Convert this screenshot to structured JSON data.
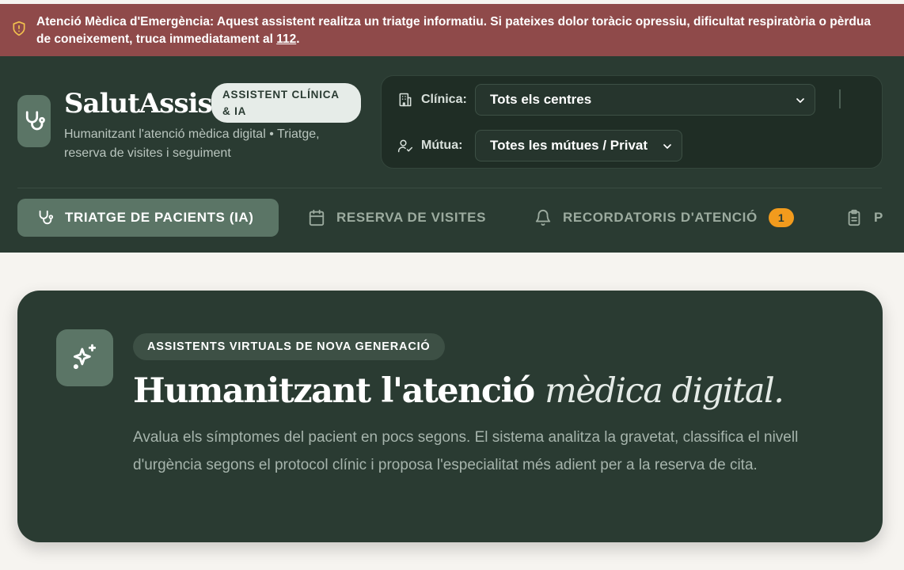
{
  "alert": {
    "title": "Atenció Mèdica d'Emergència:",
    "text": " Aquest assistent realitza un triatge informatiu. Si pateixes dolor toràcic opressiu, dificultat respiratòria o pèrdua de coneixement, truca immediatament al ",
    "phone": "112",
    "end": ".",
    "icon": "shield-alert-icon"
  },
  "brand": {
    "name": "SalutAssist",
    "badge": "ASSISTENT CLÍNICA & IA",
    "tagline": "Humanitzant l'atenció mèdica digital • Triatge, reserva de visites i seguiment",
    "icon": "stethoscope-icon"
  },
  "filters": {
    "clinic_label": "Clínica:",
    "clinic_value": "Tots els centres",
    "insurance_label": "Mútua:",
    "insurance_value": "Totes les mútues / Privat"
  },
  "tabs": [
    {
      "label": "TRIATGE DE PACIENTS (IA)",
      "icon": "stethoscope-icon",
      "active": true
    },
    {
      "label": "RESERVA DE VISITES",
      "icon": "calendar-icon",
      "active": false
    },
    {
      "label": "RECORDATORIS D'ATENCIÓ",
      "icon": "bell-icon",
      "active": false,
      "count": "1"
    },
    {
      "label": "P",
      "icon": "clipboard-icon",
      "active": false
    }
  ],
  "hero": {
    "kicker": "ASSISTENTS VIRTUALS DE NOVA GENERACIÓ",
    "title_main": "Humanitzant l'atenció ",
    "title_italic": "mèdica digital.",
    "description": "Avalua els símptomes del pacient en pocs segons. El sistema analitza la gravetat, classifica el nivell d'urgència segons el protocol clínic i proposa l'especialitat més adient per a la reserva de cita.",
    "icon": "sparkles-icon"
  },
  "colors": {
    "alert_bg": "#8f4a4a",
    "header_bg": "#2a3b32",
    "accent": "#5b7566",
    "count_badge": "#f29b1d",
    "page_bg": "#f6f4f0"
  }
}
